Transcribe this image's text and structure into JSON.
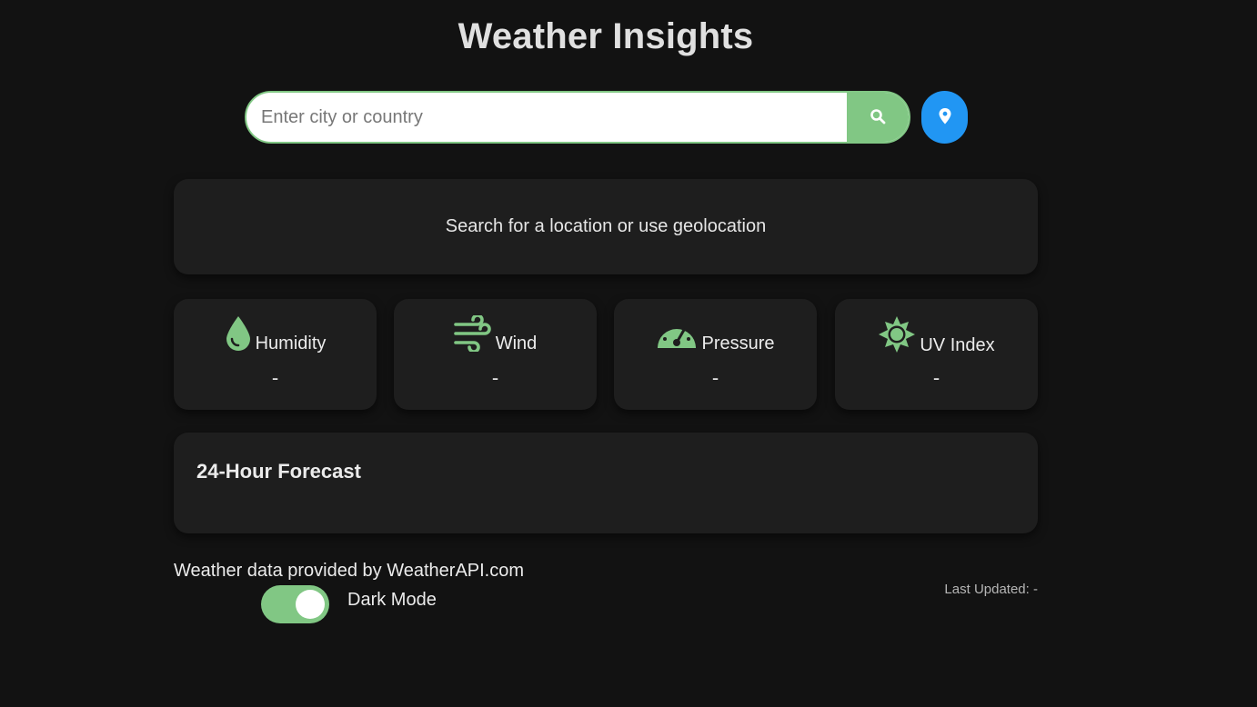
{
  "header": {
    "title": "Weather Insights"
  },
  "search": {
    "placeholder": "Enter city or country",
    "value": "",
    "search_icon": "search-icon",
    "geo_icon": "location-pin-icon"
  },
  "status": {
    "message": "Search for a location or use geolocation"
  },
  "metrics": [
    {
      "label": "Humidity",
      "value": "-",
      "icon": "droplet-icon"
    },
    {
      "label": "Wind",
      "value": "-",
      "icon": "wind-icon"
    },
    {
      "label": "Pressure",
      "value": "-",
      "icon": "gauge-icon"
    },
    {
      "label": "UV Index",
      "value": "-",
      "icon": "sun-icon"
    }
  ],
  "forecast": {
    "title": "24-Hour Forecast"
  },
  "footer": {
    "attribution": "Weather data provided by WeatherAPI.com",
    "dark_mode_label": "Dark Mode",
    "dark_mode_on": true,
    "last_updated_label": "Last Updated:",
    "last_updated_value": "-"
  },
  "colors": {
    "background": "#121212",
    "card": "#1e1e1e",
    "accent_green": "#81c784",
    "accent_blue": "#2196f3"
  }
}
